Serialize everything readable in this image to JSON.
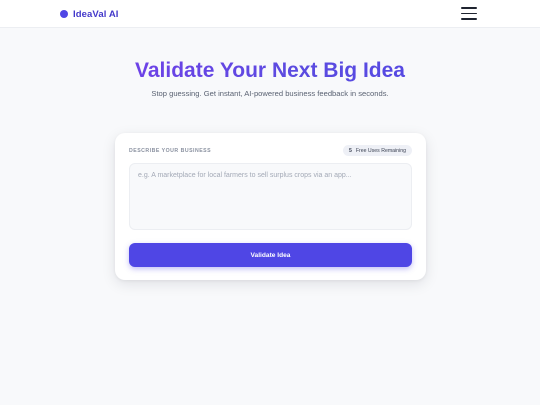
{
  "header": {
    "brand_name": "IdeaVal AI",
    "menu_icon": "hamburger-menu-icon"
  },
  "hero": {
    "title": "Validate Your Next Big Idea",
    "subtitle": "Stop guessing. Get instant, AI-powered business feedback in seconds."
  },
  "form": {
    "label": "DESCRIBE YOUR BUSINESS",
    "uses_count": "5",
    "uses_text": "Free Uses Remaining",
    "input_value": "",
    "placeholder": "e.g. A marketplace for local farmers to sell surplus crops via an app...",
    "submit_label": "Validate Idea"
  },
  "colors": {
    "accent": "#4f46e5",
    "title_gradient_start": "#7c3aed",
    "background": "#f8f9fb"
  }
}
